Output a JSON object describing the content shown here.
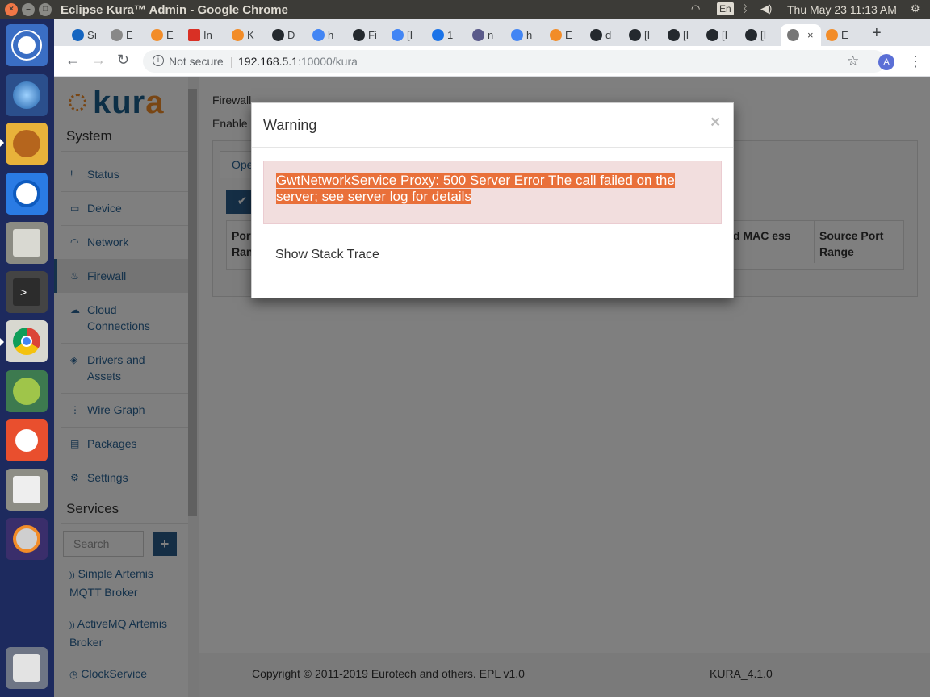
{
  "system_bar": {
    "window_title": "Eclipse Kura™ Admin - Google Chrome",
    "input_lang": "En",
    "clock": "Thu May 23 11:13 AM"
  },
  "browser": {
    "tabs": [
      {
        "label": "Sı",
        "color": "#1565c0"
      },
      {
        "label": "E",
        "color": "#888888"
      },
      {
        "label": "E",
        "color": "#f28c28"
      },
      {
        "label": "In",
        "color": "#d93025"
      },
      {
        "label": "K",
        "color": "#f28c28"
      },
      {
        "label": "D",
        "color": "#24292e"
      },
      {
        "label": "h",
        "color": "#4285f4"
      },
      {
        "label": "Fi",
        "color": "#24292e"
      },
      {
        "label": "[I",
        "color": "#4285f4"
      },
      {
        "label": "1",
        "color": "#1a73e8"
      },
      {
        "label": "n",
        "color": "#5a5a8a"
      },
      {
        "label": "h",
        "color": "#4285f4"
      },
      {
        "label": "E",
        "color": "#f28c28"
      },
      {
        "label": "d",
        "color": "#24292e"
      },
      {
        "label": "[I",
        "color": "#24292e"
      },
      {
        "label": "[I",
        "color": "#24292e"
      },
      {
        "label": "[I",
        "color": "#24292e"
      },
      {
        "label": "[I",
        "color": "#24292e"
      }
    ],
    "active_tab_close": "×",
    "last_tab": {
      "label": "E",
      "color": "#f28c28"
    },
    "new_tab": "+",
    "address": {
      "security": "Not secure",
      "host": "192.168.5.1",
      "rest": ":10000/kura"
    },
    "profile_initial": "A"
  },
  "sidebar": {
    "logo_text_main": "kur",
    "logo_text_accent": "a",
    "system_heading": "System",
    "nav": [
      {
        "label": "Status",
        "icon": "!"
      },
      {
        "label": "Device",
        "icon": "▭"
      },
      {
        "label": "Network",
        "icon": "◠"
      },
      {
        "label": "Firewall",
        "icon": "♨"
      },
      {
        "label": "Cloud Connections",
        "icon": "☁"
      },
      {
        "label": "Drivers and Assets",
        "icon": "◈"
      },
      {
        "label": "Wire Graph",
        "icon": "⋮"
      },
      {
        "label": "Packages",
        "icon": "▤"
      },
      {
        "label": "Settings",
        "icon": "⚙"
      }
    ],
    "services_heading": "Services",
    "search_placeholder": "Search",
    "add_label": "+",
    "services": [
      {
        "label": "Simple Artemis MQTT Broker",
        "icon": "))"
      },
      {
        "label": "ActiveMQ Artemis Broker",
        "icon": "))"
      },
      {
        "label": "ClockService",
        "icon": "◷"
      }
    ]
  },
  "main": {
    "title": "Firewall",
    "enable_label": "Enable",
    "tab_open": "Ope",
    "apply_icon": "✔",
    "columns": [
      "Port Range",
      "itted MAC ess",
      "Source Port Range"
    ],
    "footer": {
      "copyright": "Copyright © 2011-2019 Eurotech and others. EPL v1.0",
      "version": "KURA_4.1.0"
    }
  },
  "modal": {
    "title": "Warning",
    "close": "×",
    "error": "GwtNetworkService  Proxy: 500 Server Error The call failed on the server; see server log for details",
    "stack_trace_link": "Show Stack Trace"
  }
}
